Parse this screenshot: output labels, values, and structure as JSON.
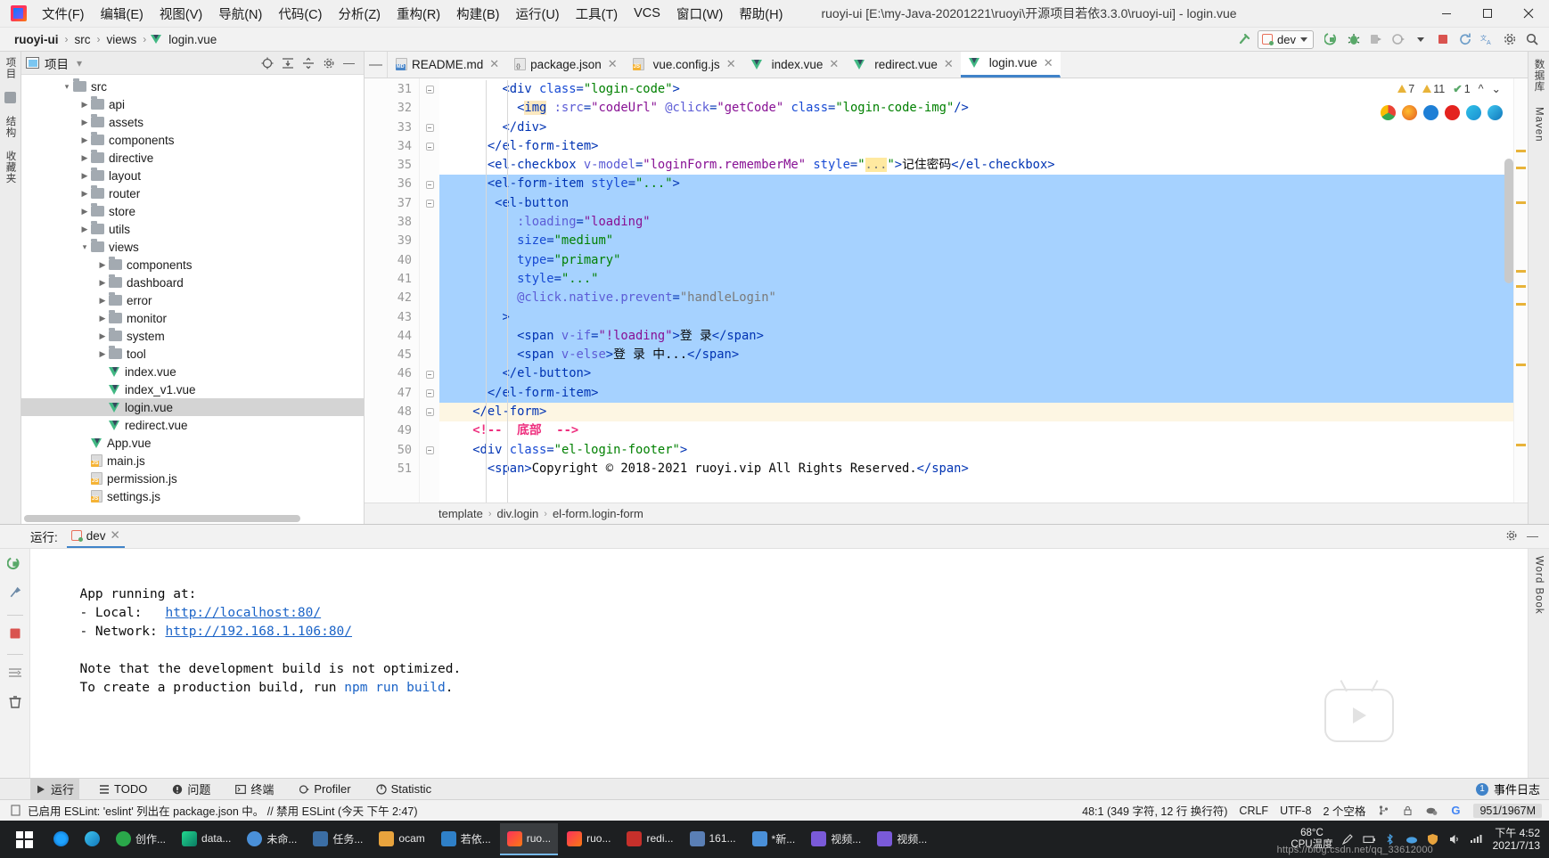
{
  "window": {
    "title": "ruoyi-ui [E:\\my-Java-20201221\\ruoyi\\开源项目若依3.3.0\\ruoyi-ui] - login.vue",
    "minimize": "—",
    "maximize": "▢",
    "close": "✕"
  },
  "menu": {
    "items": [
      {
        "label": "文件(F)"
      },
      {
        "label": "编辑(E)"
      },
      {
        "label": "视图(V)"
      },
      {
        "label": "导航(N)"
      },
      {
        "label": "代码(C)"
      },
      {
        "label": "分析(Z)"
      },
      {
        "label": "重构(R)"
      },
      {
        "label": "构建(B)"
      },
      {
        "label": "运行(U)"
      },
      {
        "label": "工具(T)"
      },
      {
        "label": "VCS"
      },
      {
        "label": "窗口(W)"
      },
      {
        "label": "帮助(H)"
      }
    ]
  },
  "navbar": {
    "breadcrumb": [
      {
        "label": "ruoyi-ui",
        "bold": true
      },
      {
        "label": "src",
        "bold": false
      },
      {
        "label": "views",
        "bold": false
      },
      {
        "label": "login.vue",
        "bold": false,
        "icon": "vue-file-icon"
      }
    ],
    "separator": "›",
    "run_config": "dev",
    "buttons": [
      {
        "name": "build-hammer-icon",
        "glyph": "🔨"
      },
      {
        "name": "run-button",
        "glyph": "▶"
      },
      {
        "name": "debug-button",
        "glyph": "🐞"
      },
      {
        "name": "run-with-coverage-button",
        "glyph": "▣"
      },
      {
        "name": "profile-button",
        "glyph": "◔"
      },
      {
        "name": "more-run-options",
        "glyph": "▾"
      },
      {
        "name": "stop-button",
        "glyph": "■"
      },
      {
        "name": "update-project-icon",
        "glyph": "⟳"
      },
      {
        "name": "translate-icon",
        "glyph": "文A"
      },
      {
        "name": "settings-icon",
        "glyph": "⚙"
      },
      {
        "name": "search-everywhere-icon",
        "glyph": "🔍"
      }
    ]
  },
  "project_panel": {
    "title": "项目",
    "dropdown": "▾",
    "tools": [
      {
        "name": "locate-file-icon",
        "glyph": "⊕"
      },
      {
        "name": "expand-all-icon",
        "glyph": "⇲"
      },
      {
        "name": "collapse-all-icon",
        "glyph": "⇱"
      },
      {
        "name": "panel-settings-icon",
        "glyph": "⚙"
      },
      {
        "name": "hide-panel-icon",
        "glyph": "—"
      }
    ],
    "tree": [
      {
        "label": "src",
        "type": "folder",
        "depth": 1,
        "expanded": true,
        "selected": false
      },
      {
        "label": "api",
        "type": "folder",
        "depth": 2,
        "expanded": false,
        "selected": false
      },
      {
        "label": "assets",
        "type": "folder",
        "depth": 2,
        "expanded": false,
        "selected": false
      },
      {
        "label": "components",
        "type": "folder",
        "depth": 2,
        "expanded": false,
        "selected": false
      },
      {
        "label": "directive",
        "type": "folder",
        "depth": 2,
        "expanded": false,
        "selected": false
      },
      {
        "label": "layout",
        "type": "folder",
        "depth": 2,
        "expanded": false,
        "selected": false
      },
      {
        "label": "router",
        "type": "folder",
        "depth": 2,
        "expanded": false,
        "selected": false
      },
      {
        "label": "store",
        "type": "folder",
        "depth": 2,
        "expanded": false,
        "selected": false
      },
      {
        "label": "utils",
        "type": "folder",
        "depth": 2,
        "expanded": false,
        "selected": false
      },
      {
        "label": "views",
        "type": "folder",
        "depth": 2,
        "expanded": true,
        "selected": false
      },
      {
        "label": "components",
        "type": "folder",
        "depth": 3,
        "expanded": false,
        "selected": false
      },
      {
        "label": "dashboard",
        "type": "folder",
        "depth": 3,
        "expanded": false,
        "selected": false
      },
      {
        "label": "error",
        "type": "folder",
        "depth": 3,
        "expanded": false,
        "selected": false
      },
      {
        "label": "monitor",
        "type": "folder",
        "depth": 3,
        "expanded": false,
        "selected": false
      },
      {
        "label": "system",
        "type": "folder",
        "depth": 3,
        "expanded": false,
        "selected": false
      },
      {
        "label": "tool",
        "type": "folder",
        "depth": 3,
        "expanded": false,
        "selected": false
      },
      {
        "label": "index.vue",
        "type": "vue",
        "depth": 3,
        "expanded": null,
        "selected": false
      },
      {
        "label": "index_v1.vue",
        "type": "vue",
        "depth": 3,
        "expanded": null,
        "selected": false
      },
      {
        "label": "login.vue",
        "type": "vue",
        "depth": 3,
        "expanded": null,
        "selected": true
      },
      {
        "label": "redirect.vue",
        "type": "vue",
        "depth": 3,
        "expanded": null,
        "selected": false
      },
      {
        "label": "App.vue",
        "type": "vue",
        "depth": 2,
        "expanded": null,
        "selected": false
      },
      {
        "label": "main.js",
        "type": "js",
        "depth": 2,
        "expanded": null,
        "selected": false
      },
      {
        "label": "permission.js",
        "type": "js",
        "depth": 2,
        "expanded": null,
        "selected": false
      },
      {
        "label": "settings.js",
        "type": "js",
        "depth": 2,
        "expanded": null,
        "selected": false
      }
    ]
  },
  "editor": {
    "collapse_glyph": "—",
    "tabs": [
      {
        "label": "README.md",
        "icon": "md-file-icon",
        "active": false
      },
      {
        "label": "package.json",
        "icon": "json-file-icon",
        "active": false
      },
      {
        "label": "vue.config.js",
        "icon": "js-file-icon",
        "active": false
      },
      {
        "label": "index.vue",
        "icon": "vue-file-icon",
        "active": false
      },
      {
        "label": "redirect.vue",
        "icon": "vue-file-icon",
        "active": false
      },
      {
        "label": "login.vue",
        "icon": "vue-file-icon",
        "active": true
      }
    ],
    "tab_close": "✕",
    "inspection": {
      "warnings": "7",
      "weak_warnings": "11",
      "typos": "1",
      "ok_glyph": "✔",
      "collapse": "^",
      "more": "⌄"
    },
    "browsers": [
      "chrome",
      "firefox",
      "edge-legacy",
      "opera",
      "edge",
      "ie"
    ],
    "first_line_number": 31,
    "lines": [
      {
        "n": 31,
        "indent": 3,
        "fold": "collapse",
        "sel": false,
        "caret": false
      },
      {
        "n": 32,
        "indent": 4,
        "fold": "none",
        "sel": false,
        "caret": false
      },
      {
        "n": 33,
        "indent": 3,
        "fold": "collapse",
        "sel": false,
        "caret": false
      },
      {
        "n": 34,
        "indent": 2,
        "fold": "collapse",
        "sel": false,
        "caret": false
      },
      {
        "n": 35,
        "indent": 2,
        "fold": "none",
        "sel": false,
        "caret": false
      },
      {
        "n": 36,
        "indent": 2,
        "fold": "collapse",
        "sel": true,
        "caret": false
      },
      {
        "n": 37,
        "indent": 3,
        "fold": "collapse",
        "sel": true,
        "caret": false
      },
      {
        "n": 38,
        "indent": 4,
        "fold": "none",
        "sel": true,
        "caret": false
      },
      {
        "n": 39,
        "indent": 4,
        "fold": "none",
        "sel": true,
        "caret": false
      },
      {
        "n": 40,
        "indent": 4,
        "fold": "none",
        "sel": true,
        "caret": false
      },
      {
        "n": 41,
        "indent": 4,
        "fold": "none",
        "sel": true,
        "caret": false
      },
      {
        "n": 42,
        "indent": 4,
        "fold": "none",
        "sel": true,
        "caret": false
      },
      {
        "n": 43,
        "indent": 3,
        "fold": "none",
        "sel": true,
        "caret": false
      },
      {
        "n": 44,
        "indent": 4,
        "fold": "none",
        "sel": true,
        "caret": false
      },
      {
        "n": 45,
        "indent": 4,
        "fold": "none",
        "sel": true,
        "caret": false
      },
      {
        "n": 46,
        "indent": 3,
        "fold": "collapse",
        "sel": true,
        "caret": false
      },
      {
        "n": 47,
        "indent": 2,
        "fold": "collapse",
        "sel": true,
        "caret": false
      },
      {
        "n": 48,
        "indent": 2,
        "fold": "collapse",
        "sel": false,
        "caret": true
      },
      {
        "n": 49,
        "indent": 2,
        "fold": "none",
        "sel": false,
        "caret": false
      },
      {
        "n": 50,
        "indent": 2,
        "fold": "collapse",
        "sel": false,
        "caret": false
      },
      {
        "n": 51,
        "indent": 3,
        "fold": "none",
        "sel": false,
        "caret": false
      }
    ],
    "code_text": [
      "        <div class=\"login-code\">",
      "          <img :src=\"codeUrl\" @click=\"getCode\" class=\"login-code-img\"/>",
      "        </div>",
      "      </el-form-item>",
      "      <el-checkbox v-model=\"loginForm.rememberMe\" style=\"...\">记住密码</el-checkbox>",
      "      <el-form-item style=\"...\">",
      "       <el-button",
      "          :loading=\"loading\"",
      "          size=\"medium\"",
      "          type=\"primary\"",
      "          style=\"...\"",
      "          @click.native.prevent=\"handleLogin\"",
      "        >",
      "          <span v-if=\"!loading\">登 录</span>",
      "          <span v-else>登 录 中...</span>",
      "        </el-button>",
      "      </el-form-item>",
      "    </el-form>",
      "    <!--  底部  -->",
      "    <div class=\"el-login-footer\">",
      "      <span>Copyright © 2018-2021 ruoyi.vip All Rights Reserved.</span>"
    ],
    "breadcrumb": [
      {
        "label": "template"
      },
      {
        "label": "div.login"
      },
      {
        "label": "el-form.login-form"
      }
    ],
    "breadcrumb_sep": "›"
  },
  "run_panel": {
    "label": "运行:",
    "tab": "dev",
    "tab_close": "✕",
    "settings_icon": "⚙",
    "hide_icon": "—",
    "side_buttons": [
      {
        "name": "rerun-button",
        "glyph": "⟳"
      },
      {
        "name": "edit-configuration-icon",
        "glyph": "🔧"
      },
      {
        "name": "stop-button",
        "glyph": "■"
      },
      {
        "name": "soft-wrap-icon",
        "glyph": "⇥"
      },
      {
        "name": "clear-all-icon",
        "glyph": "🗑"
      }
    ],
    "console": [
      "",
      "  App running at:",
      "  - Local:   http://localhost:80/",
      "  - Network: http://192.168.1.106:80/",
      "",
      "  Note that the development build is not optimized.",
      "  To create a production build, run npm run build."
    ],
    "local_url": "http://localhost:80/",
    "network_url": "http://192.168.1.106:80/",
    "local_label": "  - Local:   ",
    "network_label": "  - Network: ",
    "app_running": "  App running at:",
    "note_line": "  Note that the development build is not optimized.",
    "build_prefix": "  To create a production build, run ",
    "build_cmd": "npm run build",
    "build_suffix": "."
  },
  "bottom_stripe": {
    "items": [
      {
        "label": "运行",
        "icon": "run-icon",
        "active": true
      },
      {
        "label": "TODO",
        "icon": "todo-icon",
        "active": false
      },
      {
        "label": "问题",
        "icon": "problems-icon",
        "active": false
      },
      {
        "label": "终端",
        "icon": "terminal-icon",
        "active": false
      },
      {
        "label": "Profiler",
        "icon": "profiler-icon",
        "active": false
      },
      {
        "label": "Statistic",
        "icon": "statistic-icon",
        "active": false
      }
    ],
    "right": {
      "label": "事件日志",
      "icon": "event-log-icon",
      "badge": "1"
    }
  },
  "status_bar": {
    "message": "已启用 ESLint: 'eslint' 列出在 package.json 中。 // 禁用 ESLint (今天 下午 2:47)",
    "caret": "48:1 (349 字符, 12 行 换行符)",
    "line_separator": "CRLF",
    "encoding": "UTF-8",
    "indent": "2 个空格",
    "memory": "951/1967M",
    "icons": [
      {
        "name": "document-icon",
        "glyph": "▤"
      },
      {
        "name": "lock-icon",
        "glyph": "🔒"
      },
      {
        "name": "git-branch-icon",
        "glyph": "⑂"
      },
      {
        "name": "google-icon",
        "glyph": "G"
      }
    ]
  },
  "side_stripes": {
    "left": [
      {
        "label": "项目",
        "name": "stripe-project"
      },
      {
        "label": "",
        "name": "stripe-structure-icon"
      },
      {
        "label": "结构",
        "name": "stripe-structure"
      },
      {
        "label": "收藏夹",
        "name": "stripe-favorites"
      }
    ],
    "right": [
      {
        "label": "数据库",
        "name": "stripe-database"
      },
      {
        "label": "Maven",
        "name": "stripe-maven"
      }
    ],
    "right_bottom": {
      "label": "Word Book",
      "name": "stripe-word-book"
    }
  },
  "taskbar": {
    "apps": [
      {
        "label": "",
        "name": "task-cortana",
        "color": "#0a84ff"
      },
      {
        "label": "",
        "name": "task-edge",
        "color": "#1e7fd6"
      },
      {
        "label": "创作...",
        "name": "task-creation",
        "color": "#2aa84a"
      },
      {
        "label": "data...",
        "name": "task-datagrip",
        "color": "#1b9e77"
      },
      {
        "label": "未命...",
        "name": "task-untitled",
        "color": "#4a90d9"
      },
      {
        "label": "任务...",
        "name": "task-manager",
        "color": "#3b6ea5"
      },
      {
        "label": "ocam",
        "name": "task-ocam",
        "color": "#e8a33d"
      },
      {
        "label": "若依...",
        "name": "task-ruoyi",
        "color": "#2f80c8"
      },
      {
        "label": "ruo...",
        "name": "task-idea-ruoyi",
        "color": "#fe315d",
        "running": true
      },
      {
        "label": "ruo...",
        "name": "task-idea-ruoyi-2",
        "color": "#f97a12"
      },
      {
        "label": "redi...",
        "name": "task-redis",
        "color": "#c6302b"
      },
      {
        "label": "161...",
        "name": "task-161",
        "color": "#5a7fb5"
      },
      {
        "label": "*新...",
        "name": "task-new-doc",
        "color": "#4a90d9"
      },
      {
        "label": "视频...",
        "name": "task-video-1",
        "color": "#7a5ad9"
      },
      {
        "label": "视频...",
        "name": "task-video-2",
        "color": "#7a5ad9"
      }
    ],
    "temp_label": "68°C",
    "temp_sub": "CPU温度",
    "clock_time": "下午 4:52",
    "clock_date": "2021/7/13",
    "tray": [
      {
        "name": "tray-pen-icon",
        "glyph": "✎"
      },
      {
        "name": "tray-battery-icon",
        "glyph": "▮"
      },
      {
        "name": "tray-bluetooth-icon",
        "glyph": "ᛒ"
      },
      {
        "name": "tray-cloud-icon",
        "glyph": "☁"
      },
      {
        "name": "tray-shield-icon",
        "glyph": "🛡"
      },
      {
        "name": "tray-volume-icon",
        "glyph": "🔊"
      },
      {
        "name": "tray-network-icon",
        "glyph": "▰"
      }
    ],
    "watermark_url": "https://blog.csdn.net/qq_33612000"
  }
}
